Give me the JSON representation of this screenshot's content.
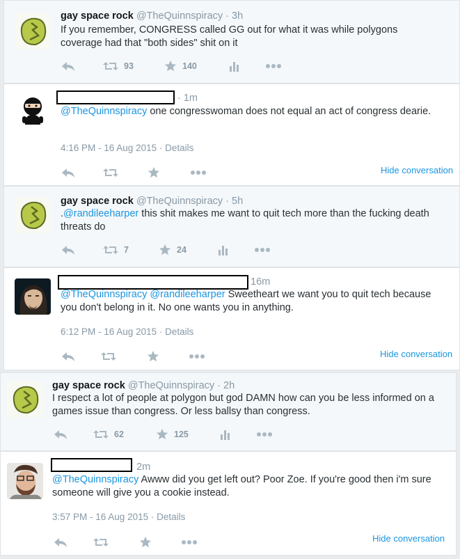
{
  "tweets": [
    {
      "name": "gay space rock",
      "handle": "@TheQuinnspiracy",
      "time": "3h",
      "text": "If you remember, CONGRESS called GG out for what it was while polygons coverage had that \"both sides\" shit on it",
      "retweets": "93",
      "likes": "140"
    },
    {
      "time": "1m",
      "mention": "@TheQuinnspiracy",
      "text": " one congresswoman does not equal an act of congress dearie.",
      "timestamp": "4:16 PM - 16 Aug 2015",
      "details": "Details",
      "hide": "Hide conversation"
    },
    {
      "name": "gay space rock",
      "handle": "@TheQuinnspiracy",
      "time": "5h",
      "prefix": ".",
      "mention": "@randileeharper",
      "text": " this shit makes me want to quit tech more than the fucking death threats do",
      "retweets": "7",
      "likes": "24"
    },
    {
      "time": "16m",
      "mention": "@TheQuinnspiracy",
      "mention2": "@randileeharper",
      "text": " Sweetheart we want you to quit tech because you don't belong in it. No one wants you in anything.",
      "timestamp": "6:12 PM - 16 Aug 2015",
      "details": "Details",
      "hide": "Hide conversation"
    },
    {
      "name": "gay space rock",
      "handle": "@TheQuinnspiracy",
      "time": "2h",
      "text": "I respect a lot of people at polygon but god DAMN how can you be less informed on a games issue than congress. Or less ballsy than congress.",
      "retweets": "62",
      "likes": "125"
    },
    {
      "time": "2m",
      "mention": "@TheQuinnspiracy",
      "text": " Awww did you get left out? Poor Zoe. If you're good then i'm sure someone will give you a cookie instead.",
      "timestamp": "3:57 PM - 16 Aug 2015",
      "details": "Details",
      "hide": "Hide conversation"
    }
  ],
  "separator": " · ",
  "icons": [
    "reply-icon",
    "retweet-icon",
    "like-icon",
    "analytics-icon",
    "more-icon"
  ],
  "colors": {
    "link": "#1b95e0",
    "name": "#14171a",
    "meta": "#8899a6",
    "icon": "#aab8c2"
  }
}
